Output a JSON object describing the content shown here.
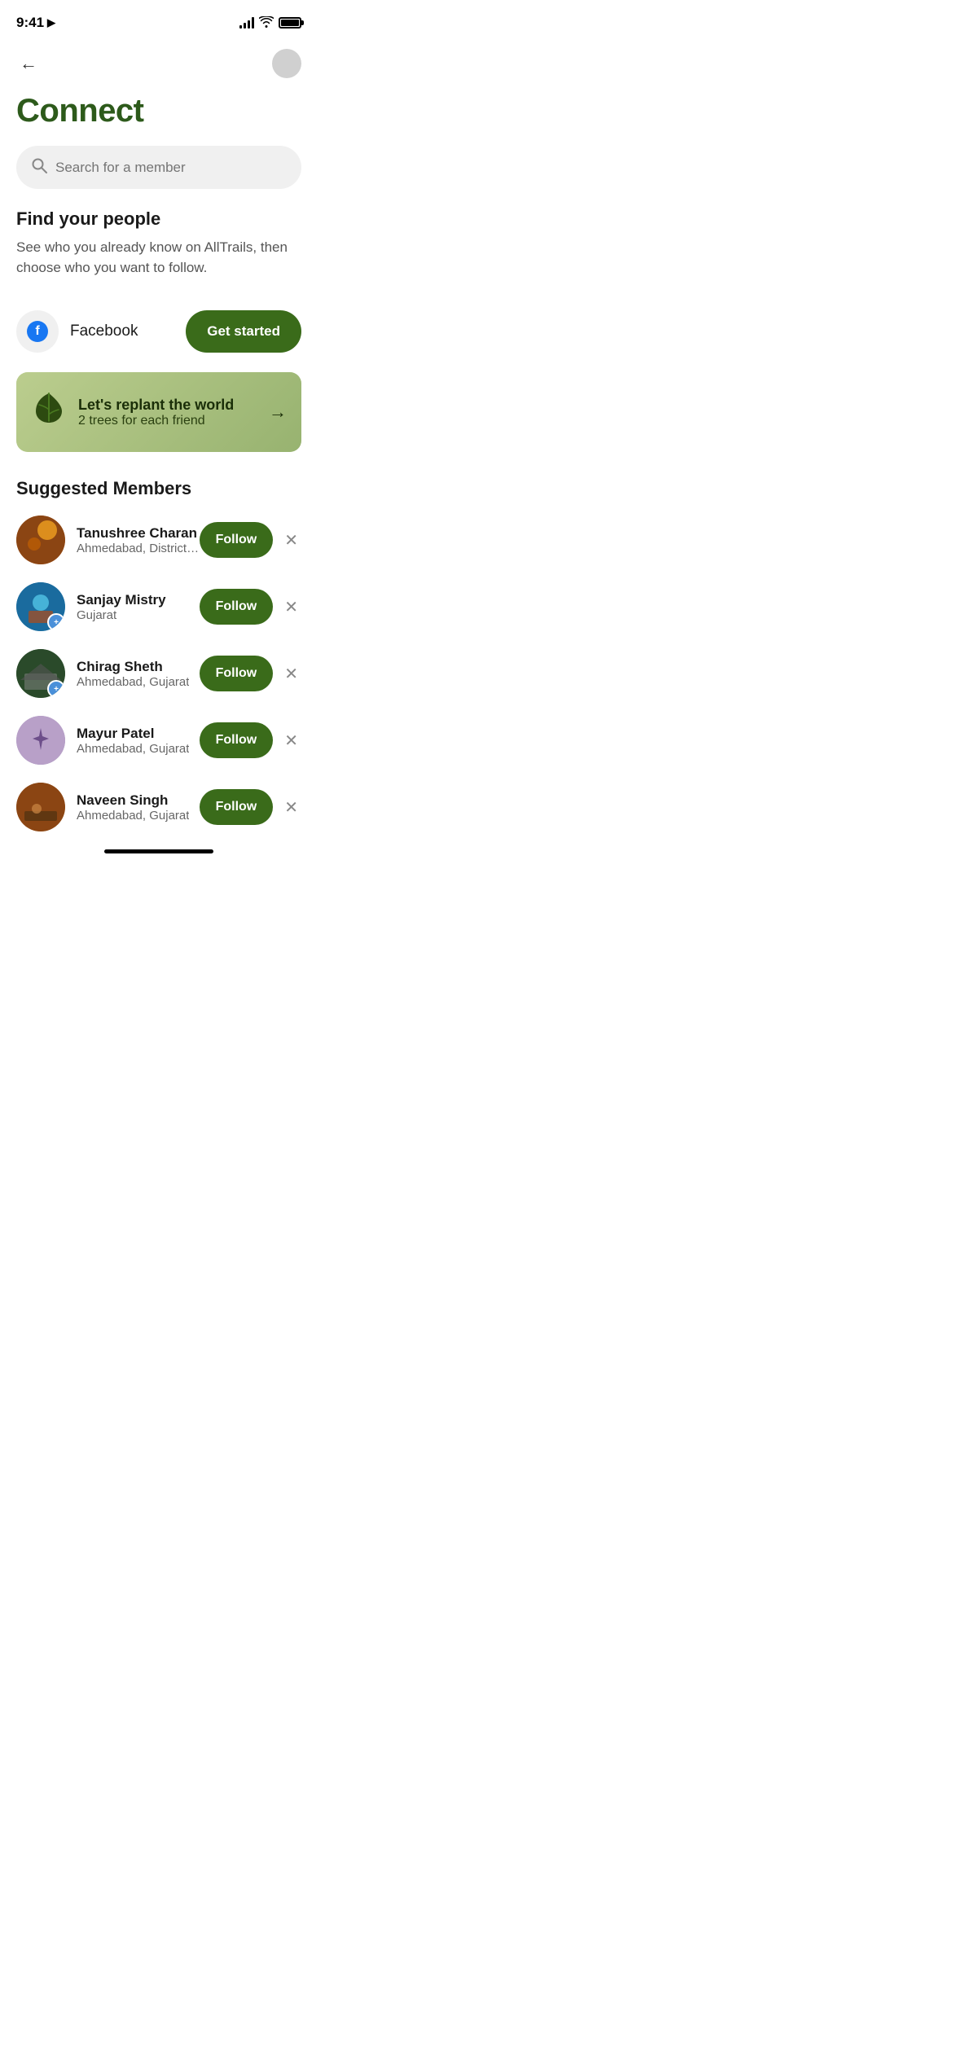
{
  "statusBar": {
    "time": "9:41",
    "locationArrow": "▶"
  },
  "header": {
    "backLabel": "←"
  },
  "page": {
    "title": "Connect"
  },
  "search": {
    "placeholder": "Search for a member"
  },
  "findSection": {
    "title": "Find your people",
    "description": "See who you already know on AllTrails, then choose who you want to follow."
  },
  "facebookRow": {
    "label": "Facebook",
    "buttonLabel": "Get started"
  },
  "replantBanner": {
    "title": "Let's replant the world",
    "subtitle": "2 trees for each friend",
    "arrow": "→"
  },
  "suggestedSection": {
    "title": "Suggested Members",
    "members": [
      {
        "name": "Tanushree Charan",
        "location": "Ahmedabad, District of Colu...",
        "followLabel": "Follow",
        "hasBadge": false
      },
      {
        "name": "Sanjay Mistry",
        "location": "Gujarat",
        "followLabel": "Follow",
        "hasBadge": true
      },
      {
        "name": "Chirag Sheth",
        "location": "Ahmedabad, Gujarat",
        "followLabel": "Follow",
        "hasBadge": true
      },
      {
        "name": "Mayur Patel",
        "location": "Ahmedabad, Gujarat",
        "followLabel": "Follow",
        "hasBadge": false
      },
      {
        "name": "Naveen Singh",
        "location": "Ahmedabad, Gujarat",
        "followLabel": "Follow",
        "hasBadge": false
      }
    ]
  }
}
